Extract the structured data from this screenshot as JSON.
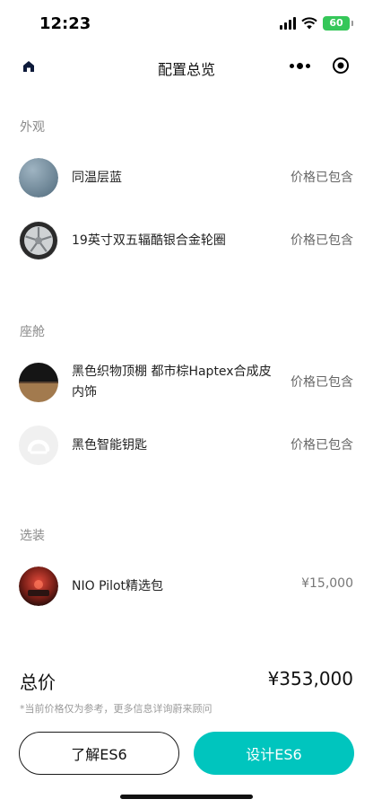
{
  "status": {
    "time": "12:23",
    "battery": "60"
  },
  "nav": {
    "title": "配置总览"
  },
  "sections": [
    {
      "label": "外观"
    },
    {
      "label": "座舱"
    },
    {
      "label": "选装"
    }
  ],
  "items": [
    {
      "name": "同温层蓝",
      "price": "价格已包含",
      "icon": "blue-paint-swatch"
    },
    {
      "name": "19英寸双五辐酷银合金轮圈",
      "price": "价格已包含",
      "icon": "alloy-wheel"
    },
    {
      "name": "黑色织物顶棚 都市棕Haptex合成皮内饰",
      "price": "价格已包含",
      "icon": "interior-swatch"
    },
    {
      "name": "黑色智能钥匙",
      "price": "价格已包含",
      "icon": "smart-key"
    },
    {
      "name": "NIO Pilot精选包",
      "price": "¥15,000",
      "icon": "nio-pilot"
    }
  ],
  "summary": {
    "total_label": "总价",
    "total_value": "¥353,000",
    "disclaimer": "*当前价格仅为参考，更多信息详询蔚来顾问"
  },
  "buttons": {
    "learn": "了解ES6",
    "design": "设计ES6"
  },
  "colors": {
    "accent": "#00c5be",
    "paint": "#7d97a8"
  }
}
